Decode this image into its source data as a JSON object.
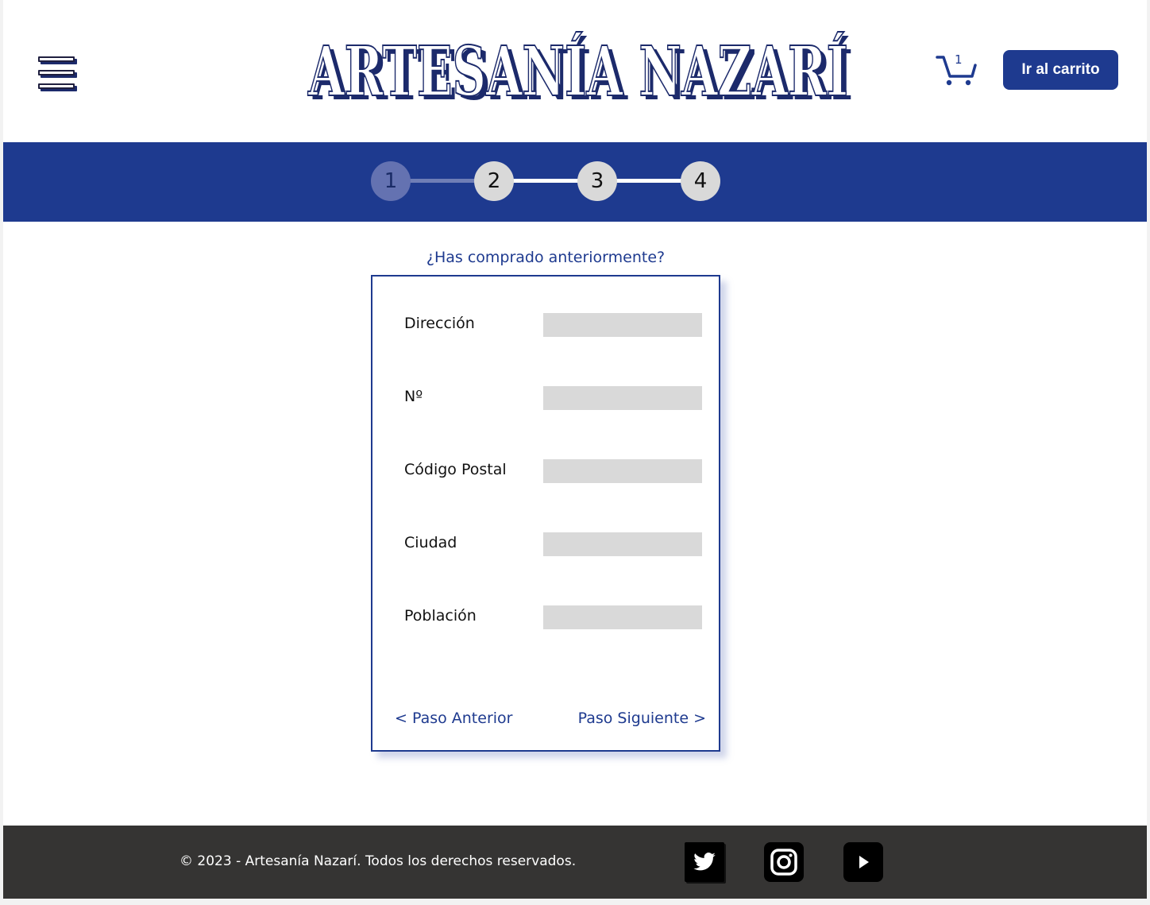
{
  "header": {
    "logo_text": "ARTESANÍA NAZARÍ",
    "cart": {
      "count": "1",
      "button_label": "Ir al carrito"
    }
  },
  "stepper": {
    "steps": [
      "1",
      "2",
      "3",
      "4"
    ],
    "current_step": 1
  },
  "form": {
    "question_link": "¿Has comprado anteriormente?",
    "fields": [
      {
        "label": "Dirección",
        "value": ""
      },
      {
        "label": "Nº",
        "value": ""
      },
      {
        "label": "Código Postal",
        "value": ""
      },
      {
        "label": "Ciudad",
        "value": ""
      },
      {
        "label": "Población",
        "value": ""
      }
    ],
    "prev_label": "<  Paso Anterior",
    "next_label": "Paso Siguiente  >"
  },
  "footer": {
    "copyright": "© 2023 - Artesanía Nazarí. Todos los derechos reservados.",
    "social": [
      "twitter-icon",
      "instagram-icon",
      "youtube-icon"
    ]
  },
  "colors": {
    "brand": "#1e3a8f",
    "step_active": "#6472b1",
    "step_idle": "#d9d9d9",
    "footer_bg": "#353433",
    "input_bg": "#d9d9d9"
  }
}
